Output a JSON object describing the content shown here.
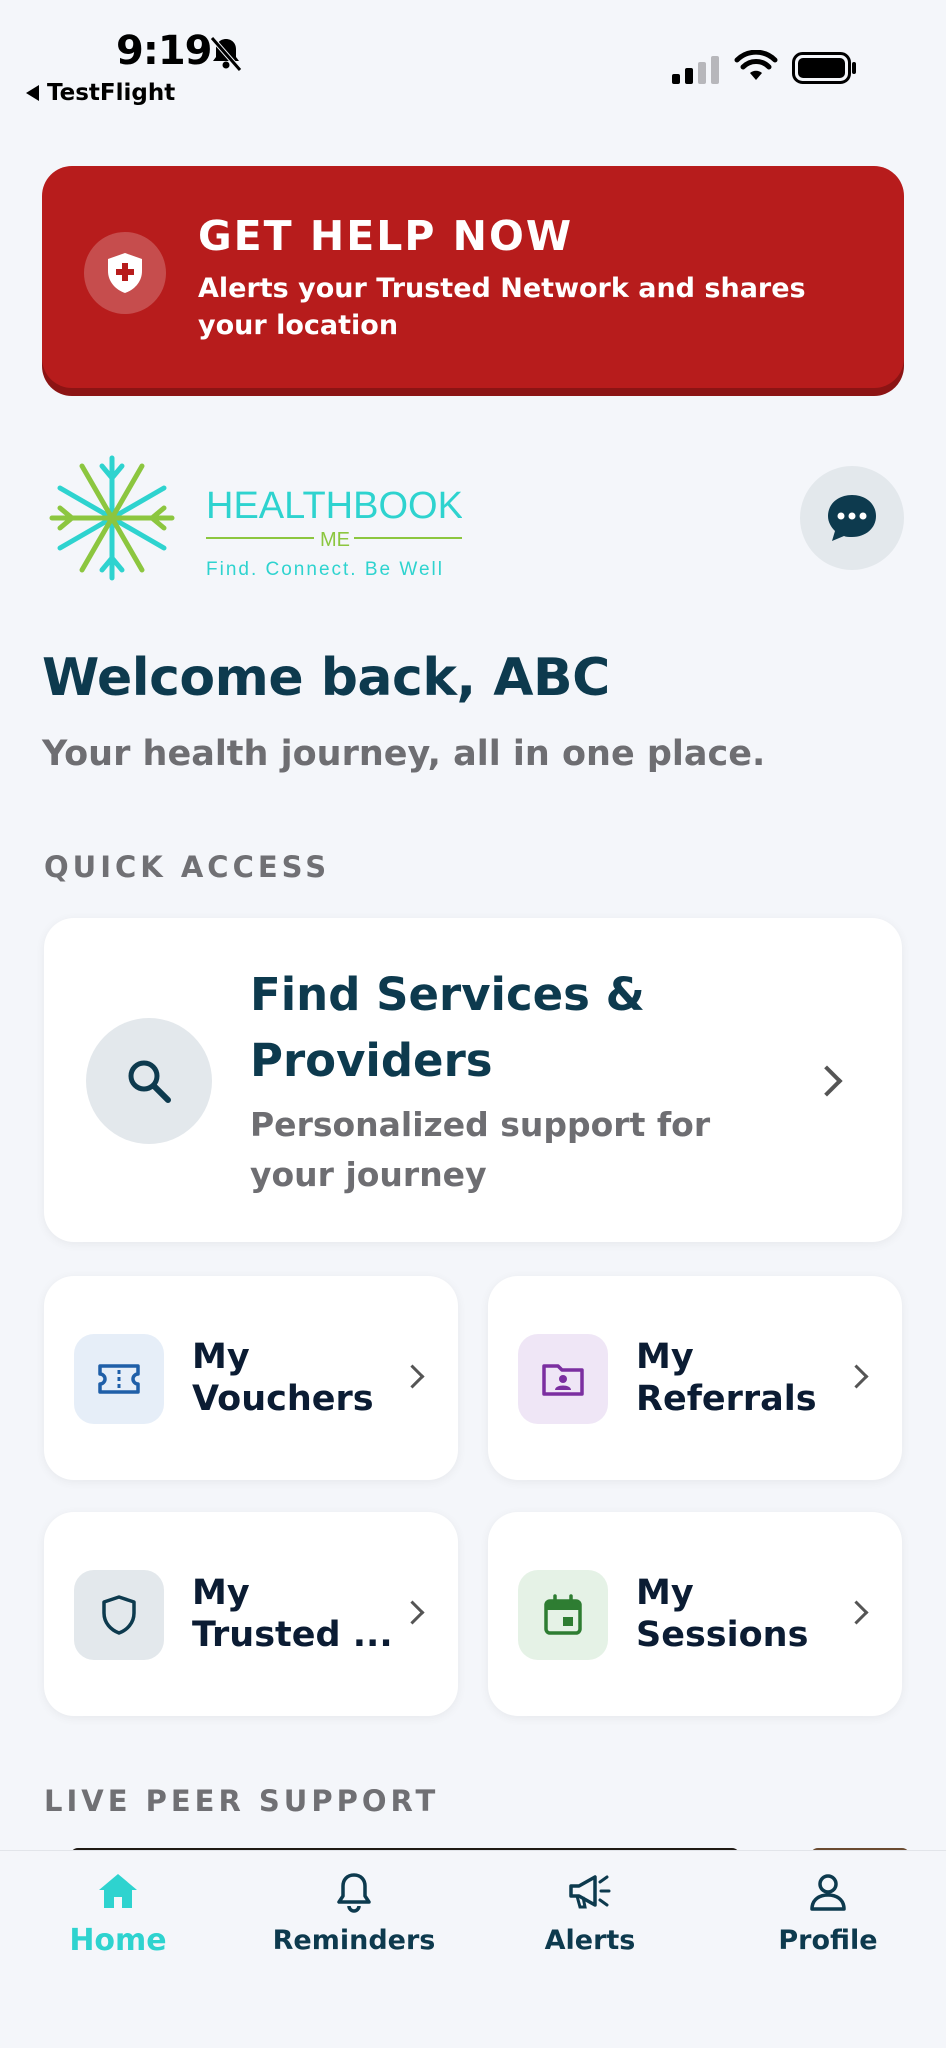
{
  "status": {
    "time": "9:19",
    "back_app": "TestFlight"
  },
  "help": {
    "title": "GET HELP NOW",
    "subtitle": "Alerts your Trusted Network and shares your location"
  },
  "logo": {
    "name": "HEALTHBOOK",
    "sub": "ME",
    "tagline": "Find. Connect. Be Well"
  },
  "welcome": {
    "heading": "Welcome back, ABC",
    "tagline": "Your health journey, all in one place."
  },
  "sections": {
    "quick_access": "QUICK ACCESS",
    "live_peer": "LIVE PEER SUPPORT"
  },
  "find_services": {
    "title": "Find Services & Providers",
    "description": "Personalized support for your journey"
  },
  "tiles": [
    {
      "label": "My\nVouchers",
      "icon": "voucher-icon",
      "bg": "#e6eef8",
      "color": "#1f5fa8"
    },
    {
      "label": "My\nReferrals",
      "icon": "referral-folder-icon",
      "bg": "#efe6f6",
      "color": "#7b2fa0"
    },
    {
      "label": "My\nTrusted ...",
      "icon": "shield-icon",
      "bg": "#e3e8ec",
      "color": "#0d3a4e"
    },
    {
      "label": "My\nSessions",
      "icon": "calendar-icon",
      "bg": "#e5f2e6",
      "color": "#2e7d32"
    }
  ],
  "tabs": [
    {
      "label": "Home",
      "icon": "home-icon"
    },
    {
      "label": "Reminders",
      "icon": "bell-icon"
    },
    {
      "label": "Alerts",
      "icon": "megaphone-icon"
    },
    {
      "label": "Profile",
      "icon": "person-icon"
    }
  ],
  "colors": {
    "emergency": "#b71c1c",
    "brand_teal": "#2ed3cf",
    "heading": "#0d3a4e",
    "background": "#f4f6fa"
  }
}
